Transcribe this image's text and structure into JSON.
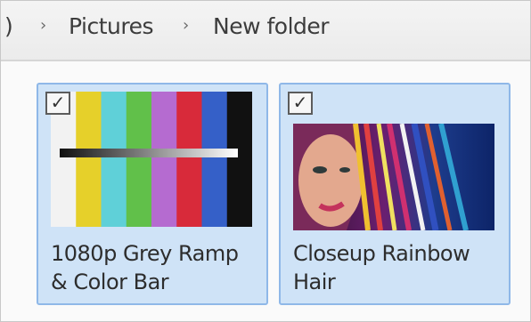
{
  "breadcrumb": {
    "leading": ")",
    "items": [
      {
        "label": "Pictures"
      },
      {
        "label": "New folder"
      }
    ],
    "separator": "›"
  },
  "files": [
    {
      "name_line1": "1080p Grey Ramp",
      "name_line2": "& Color Bar",
      "selected": true,
      "thumbnail": "color-bars-test-pattern",
      "bar_colors": [
        "#f2f2f2",
        "#e6d02a",
        "#5fd0d8",
        "#61c04a",
        "#b56bd0",
        "#d82a3a",
        "#3560c8",
        "#111111"
      ]
    },
    {
      "name_line1": "Closeup Rainbow",
      "name_line2": "Hair",
      "selected": true,
      "thumbnail": "rainbow-hair-photo"
    }
  ],
  "colors": {
    "selection_fill": "#cfe3f7",
    "selection_border": "#8fb8e8"
  }
}
